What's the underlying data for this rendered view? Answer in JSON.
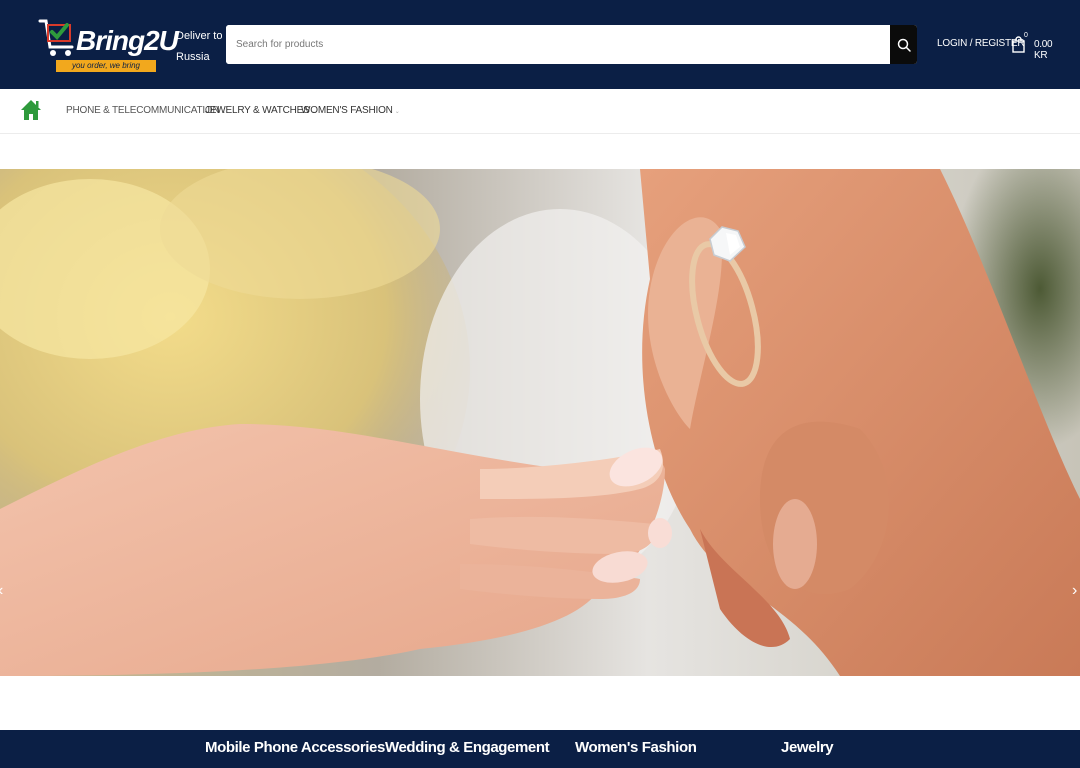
{
  "brand": {
    "name_prefix": "Bring",
    "name_suffix": "2U",
    "tagline": "you order, we bring"
  },
  "header": {
    "deliver_label": "Deliver to",
    "deliver_country": "Russia",
    "search_placeholder": "Search for products",
    "login_label": "LOGIN / REGISTER",
    "cart_count": "0",
    "cart_total": "0.00 KR"
  },
  "nav": {
    "items": [
      {
        "label": "PHONE & TELECOMMUNICATION"
      },
      {
        "label": "JEWELRY & WATCHES"
      },
      {
        "label": "WOMEN'S FASHION"
      }
    ]
  },
  "categories": [
    {
      "label": "Mobile Phone Accessories"
    },
    {
      "label": "Wedding & Engagement"
    },
    {
      "label": "Women's Fashion"
    },
    {
      "label": "Jewelry"
    }
  ],
  "colors": {
    "header_bg": "#0b1f45",
    "home_icon": "#2e9a3c",
    "tagline_bg": "#f2a81d"
  },
  "icons": {
    "home": "home-icon",
    "search": "search-icon",
    "cart": "shopping-bag-icon",
    "prev": "chevron-left-icon",
    "next": "chevron-right-icon"
  }
}
